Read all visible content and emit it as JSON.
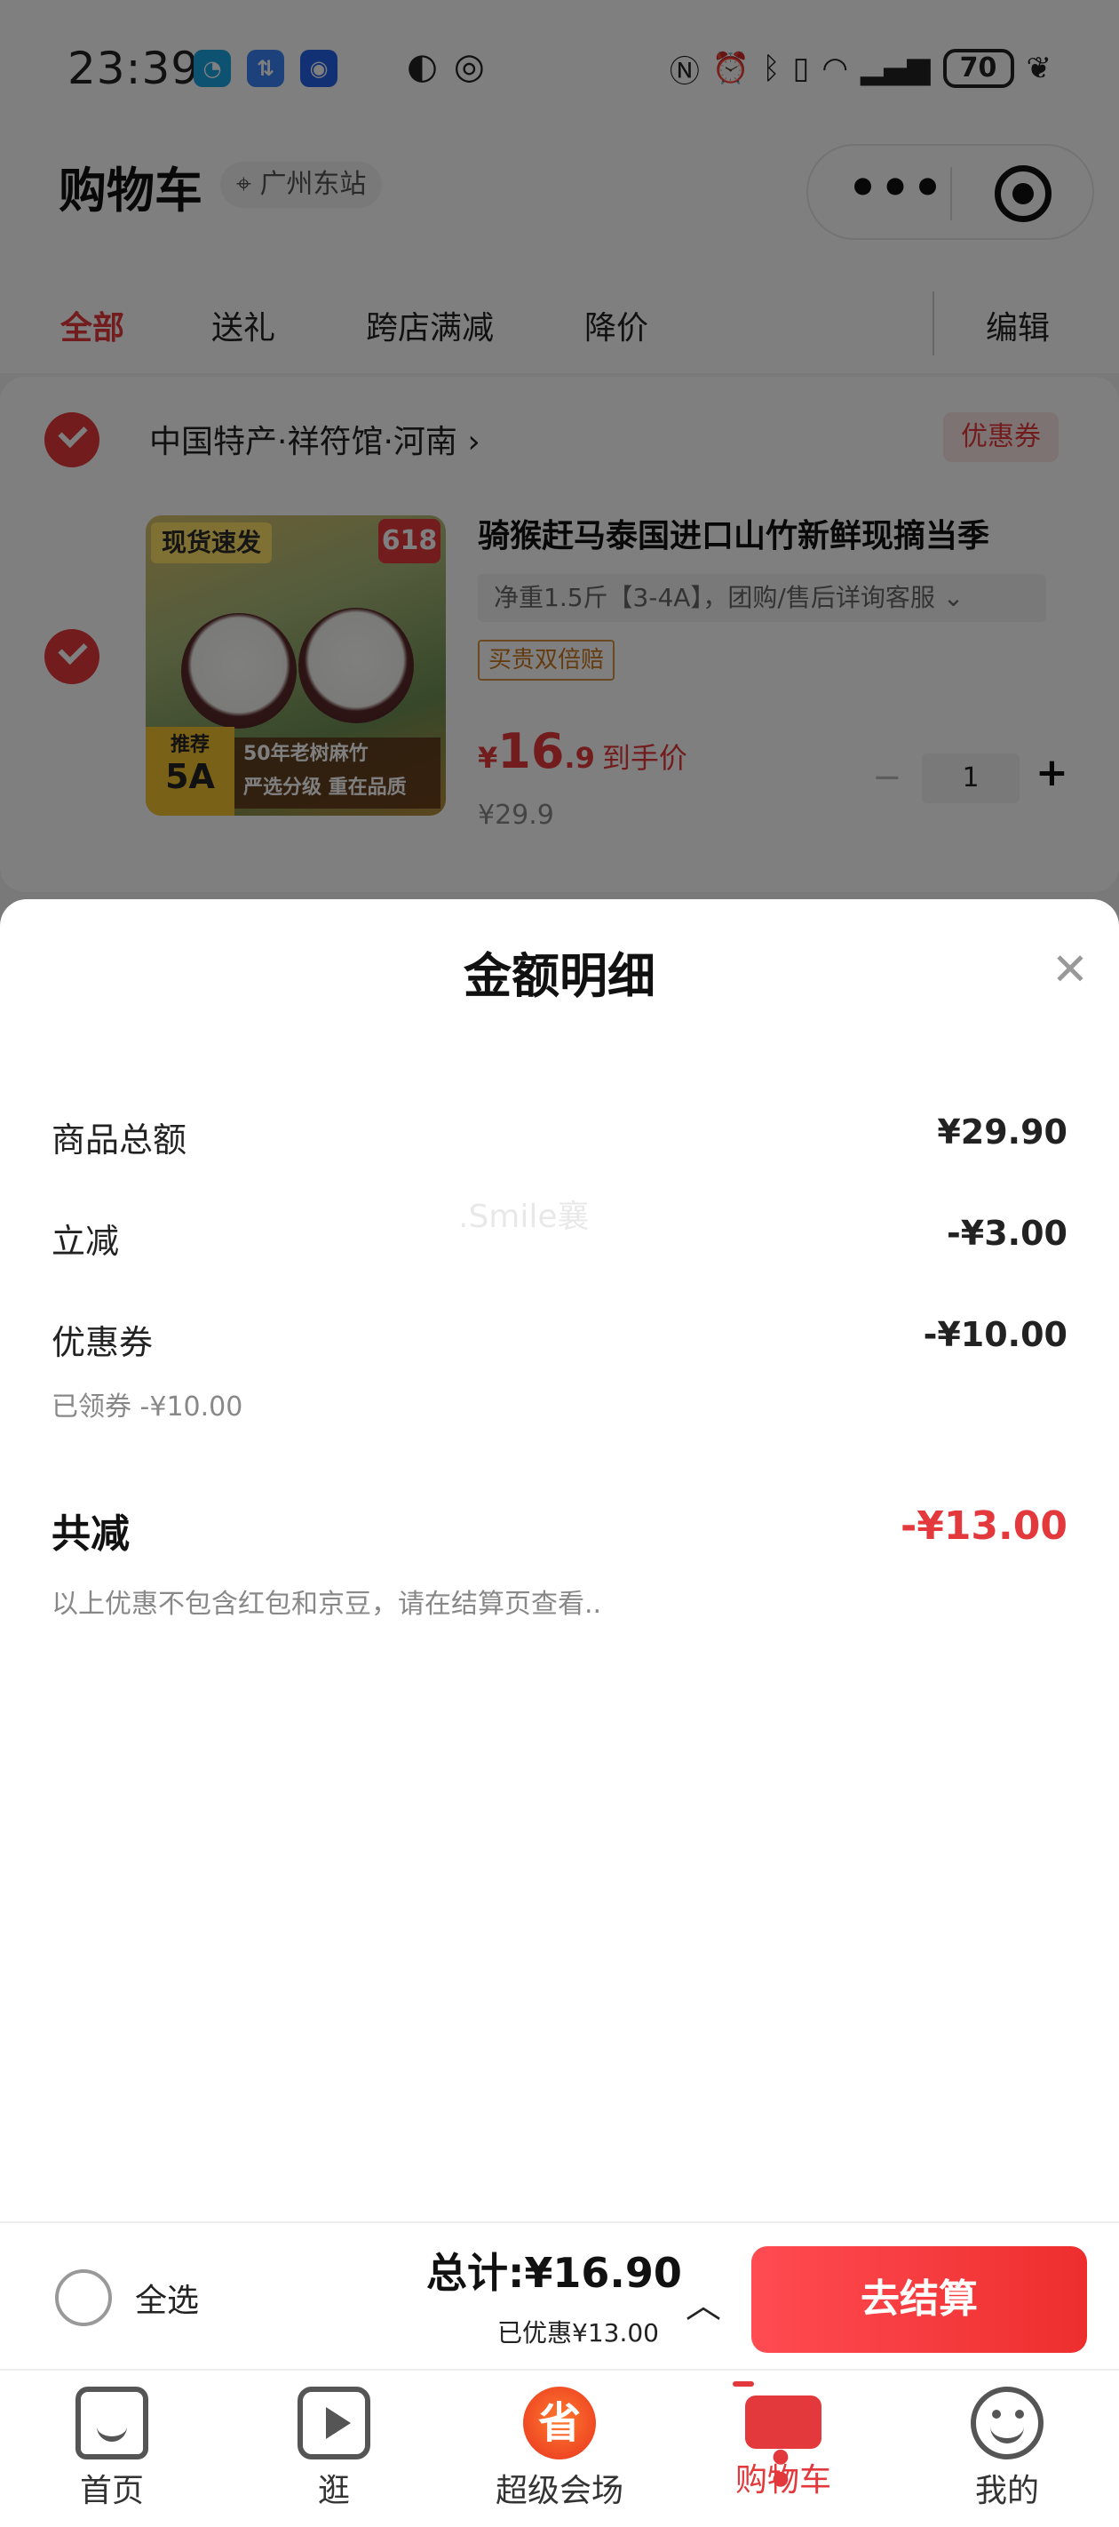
{
  "status_bar": {
    "time": "23:39",
    "battery": "70",
    "icons": [
      "app-1-icon",
      "app-2-icon",
      "app-618-icon",
      "vpn-icon",
      "eye-icon",
      "nfc-icon",
      "alarm-icon",
      "bluetooth-icon",
      "vibrate-icon",
      "wifi-6-icon",
      "signal-icon",
      "battery-icon",
      "leaf-icon"
    ]
  },
  "header": {
    "title": "购物车",
    "location": "广州东站"
  },
  "tabs": [
    {
      "label": "全部",
      "active": true
    },
    {
      "label": "送礼",
      "active": false
    },
    {
      "label": "跨店满减",
      "active": false
    },
    {
      "label": "降价",
      "active": false
    }
  ],
  "edit_label": "编辑",
  "store": {
    "name": "中国特产·祥符馆·河南",
    "coupon_tag": "优惠券",
    "checked": true
  },
  "product": {
    "title": "骑猴赶马泰国进口山竹新鲜现摘当季",
    "spec": "净重1.5斤【3-4A】，团购/售后详询客服",
    "guarantee": "买贵双倍赔",
    "price_symbol": "¥",
    "price_int": "16",
    "price_dec": ".9",
    "price_suffix": "到手价",
    "original_price": "¥29.9",
    "quantity": "1",
    "image_badges": {
      "top_left": "现货速发",
      "top_right": "618",
      "bottom_left_small": "推荐",
      "bottom_left_big": "5A",
      "strip_line1": "50年老树麻竹",
      "strip_line2": "严选分级 重在品质"
    }
  },
  "sheet": {
    "title": "金额明细",
    "rows": [
      {
        "label": "商品总额",
        "value": "¥29.90"
      },
      {
        "label": "立减",
        "value": "-¥3.00"
      },
      {
        "label": "优惠券",
        "value": "-¥10.00",
        "sub": "已领券 -¥10.00"
      }
    ],
    "total_label": "共减",
    "total_value": "-¥13.00",
    "note": "以上优惠不包含红包和京豆，请在结算页查看..",
    "watermark": ".Smile襄"
  },
  "checkout": {
    "select_all": "全选",
    "total": "总计:¥16.90",
    "saved": "已优惠¥13.00",
    "pay_button": "去结算"
  },
  "tab_bar": [
    {
      "label": "首页",
      "icon": "home-icon",
      "active": false
    },
    {
      "label": "逛",
      "icon": "play-icon",
      "active": false
    },
    {
      "label": "超级会场",
      "icon": "mega-venue-icon",
      "active": false
    },
    {
      "label": "购物车",
      "icon": "cart-icon",
      "active": true
    },
    {
      "label": "我的",
      "icon": "profile-icon",
      "active": false
    }
  ],
  "colors": {
    "accent": "#e4393c",
    "overlay": "rgba(0,0,0,0.5)"
  }
}
